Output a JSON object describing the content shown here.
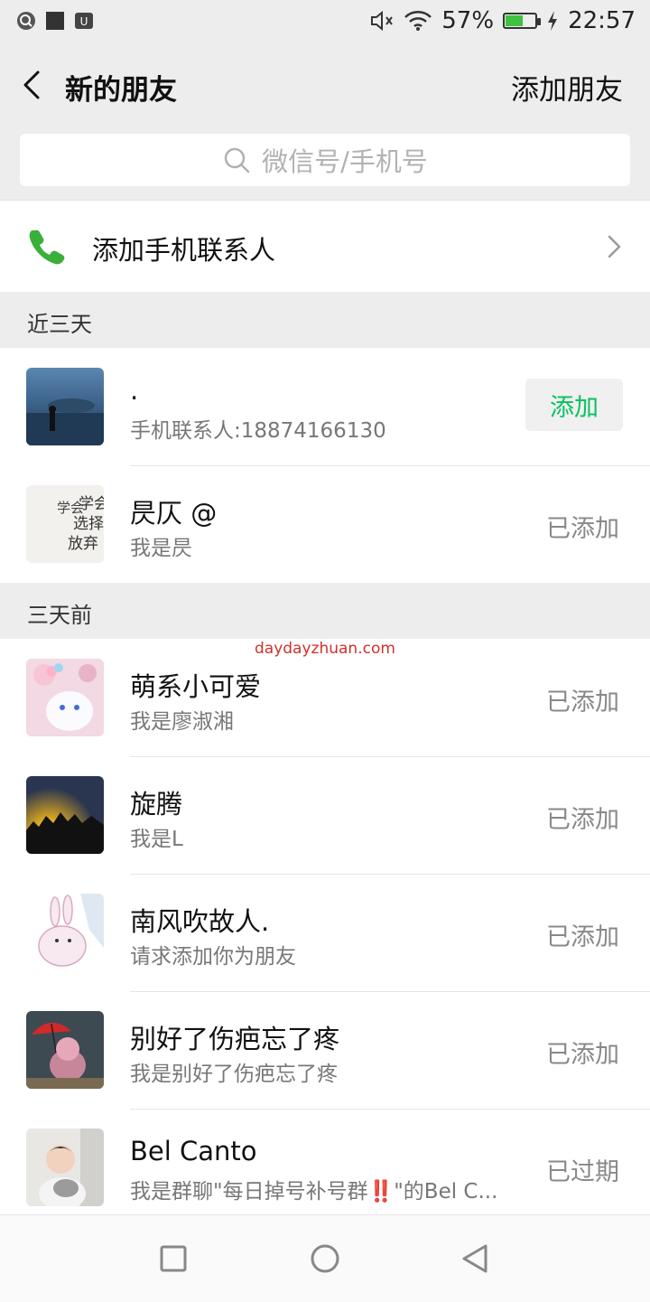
{
  "status_bar": {
    "battery_percent": "57%",
    "battery_level": 0.57,
    "time": "22:57",
    "icons": [
      "search-icon",
      "square-icon",
      "app-icon",
      "mute-icon",
      "wifi-icon",
      "battery-icon",
      "charging-icon"
    ]
  },
  "header": {
    "title": "新的朋友",
    "add_friend_label": "添加朋友"
  },
  "search": {
    "placeholder": "微信号/手机号"
  },
  "phone_contacts": {
    "label": "添加手机联系人"
  },
  "sections": {
    "recent": "近三天",
    "earlier": "三天前"
  },
  "recent_friends": [
    {
      "name": ".",
      "subtitle": "手机联系人:18874166130",
      "action": "添加"
    },
    {
      "name": "昃仄 @",
      "subtitle": "我是昃",
      "status": "已添加"
    }
  ],
  "earlier_friends": [
    {
      "name": "萌系小可爱",
      "subtitle": "我是廖淑湘",
      "status": "已添加"
    },
    {
      "name": "旋腾",
      "subtitle": "我是L",
      "status": "已添加"
    },
    {
      "name": "南风吹故人.",
      "subtitle": "请求添加你为朋友",
      "status": "已添加"
    },
    {
      "name": "别好了伤疤忘了疼",
      "subtitle": "我是别好了伤疤忘了疼",
      "status": "已添加"
    },
    {
      "name": "Bel Canto",
      "subtitle": "我是群聊\"每日掉号补号群‼️\"的Bel C...",
      "status": "已过期"
    }
  ],
  "watermark": "daydayzhuan.com",
  "colors": {
    "accent": "#07c160",
    "background": "#ededed"
  }
}
